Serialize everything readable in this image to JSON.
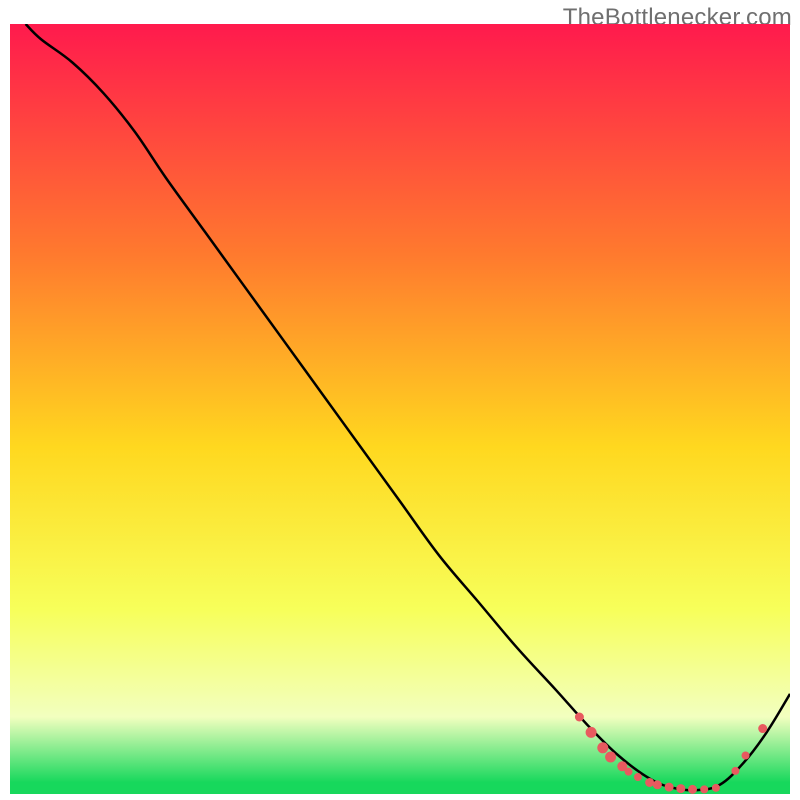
{
  "watermark": "TheBottlenecker.com",
  "colors": {
    "top": "#ff1a4d",
    "upper_mid": "#ff7a2e",
    "mid": "#ffd81f",
    "lower_mid": "#f7ff5a",
    "pale": "#f2ffbf",
    "green": "#17d85c",
    "curve": "#000000",
    "marker_fill": "#e85a5f",
    "marker_stroke": "#c73d42"
  },
  "chart_data": {
    "type": "line",
    "title": "",
    "xlabel": "",
    "ylabel": "",
    "xlim": [
      0,
      100
    ],
    "ylim": [
      0,
      100
    ],
    "series": [
      {
        "name": "bottleneck-curve",
        "x": [
          2,
          4,
          8,
          12,
          16,
          20,
          25,
          30,
          35,
          40,
          45,
          50,
          55,
          60,
          65,
          70,
          74,
          78,
          82,
          85,
          88,
          91,
          94,
          97,
          100
        ],
        "y": [
          100,
          98,
          95,
          91,
          86,
          80,
          73,
          66,
          59,
          52,
          45,
          38,
          31,
          25,
          19,
          13.5,
          9,
          5,
          2,
          0.8,
          0.5,
          1.2,
          4,
          8,
          13
        ]
      }
    ],
    "markers": {
      "name": "highlight-cluster",
      "points": [
        {
          "x": 73,
          "y": 10,
          "r": 4.5
        },
        {
          "x": 74.5,
          "y": 8,
          "r": 5.5
        },
        {
          "x": 76,
          "y": 6,
          "r": 5.5
        },
        {
          "x": 77,
          "y": 4.8,
          "r": 5.5
        },
        {
          "x": 78.5,
          "y": 3.6,
          "r": 5
        },
        {
          "x": 79.3,
          "y": 2.9,
          "r": 4
        },
        {
          "x": 80.5,
          "y": 2.2,
          "r": 4
        },
        {
          "x": 82,
          "y": 1.5,
          "r": 4.5
        },
        {
          "x": 83,
          "y": 1.2,
          "r": 4.5
        },
        {
          "x": 84.5,
          "y": 0.9,
          "r": 4.5
        },
        {
          "x": 86,
          "y": 0.7,
          "r": 4.5
        },
        {
          "x": 87.5,
          "y": 0.6,
          "r": 4.5
        },
        {
          "x": 89,
          "y": 0.6,
          "r": 4
        },
        {
          "x": 90.5,
          "y": 0.8,
          "r": 4
        },
        {
          "x": 93,
          "y": 3,
          "r": 4
        },
        {
          "x": 94.3,
          "y": 5,
          "r": 4
        },
        {
          "x": 96.5,
          "y": 8.5,
          "r": 4.5
        }
      ]
    },
    "gradient_stops": [
      {
        "offset": 0.0,
        "key": "top"
      },
      {
        "offset": 0.3,
        "key": "upper_mid"
      },
      {
        "offset": 0.55,
        "key": "mid"
      },
      {
        "offset": 0.76,
        "key": "lower_mid"
      },
      {
        "offset": 0.9,
        "key": "pale"
      },
      {
        "offset": 0.985,
        "key": "green"
      },
      {
        "offset": 1.0,
        "key": "green"
      }
    ]
  }
}
